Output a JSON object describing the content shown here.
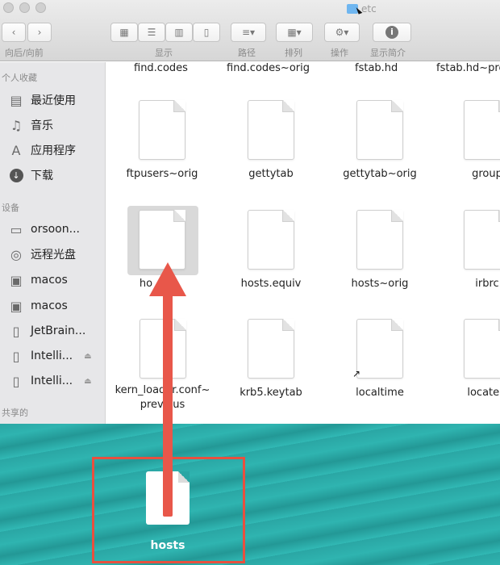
{
  "window": {
    "title": "etc"
  },
  "toolbar": {
    "nav_label": "向后/向前",
    "view_label": "显示",
    "path_label": "路径",
    "arrange_label": "排列",
    "action_label": "操作",
    "info_label": "显示简介"
  },
  "sidebar": {
    "favorites_header": "个人收藏",
    "devices_header": "设备",
    "shared_header": "共享的",
    "favorites": [
      {
        "label": "最近使用",
        "icon": "recents-icon"
      },
      {
        "label": "音乐",
        "icon": "music-icon"
      },
      {
        "label": "应用程序",
        "icon": "applications-icon"
      },
      {
        "label": "下载",
        "icon": "downloads-icon"
      }
    ],
    "devices": [
      {
        "label": "orsoon...",
        "icon": "computer-icon"
      },
      {
        "label": "远程光盘",
        "icon": "disc-icon"
      },
      {
        "label": "macos",
        "icon": "disk-icon"
      },
      {
        "label": "macos",
        "icon": "disk-icon"
      },
      {
        "label": "JetBrain...",
        "icon": "file-icon"
      },
      {
        "label": "Intelli...",
        "icon": "drive-icon"
      },
      {
        "label": "Intelli...",
        "icon": "drive-icon"
      }
    ]
  },
  "files": {
    "top_row": [
      "find.codes",
      "find.codes~orig",
      "fstab.hd",
      "fstab.hd~pre"
    ],
    "row1": [
      "ftpusers~orig",
      "gettytab",
      "gettytab~orig",
      "group"
    ],
    "row2": [
      "hosts",
      "hosts.equiv",
      "hosts~orig",
      "irbrc"
    ],
    "row3": [
      "kern_loader.conf~\nprevious",
      "krb5.keytab",
      "localtime",
      "locate.r"
    ],
    "visible_selected_label": "ho"
  },
  "desktop": {
    "file_label": "hosts"
  },
  "colors": {
    "accent_red": "#e8574a",
    "desktop_teal": "#2aa6a4"
  }
}
